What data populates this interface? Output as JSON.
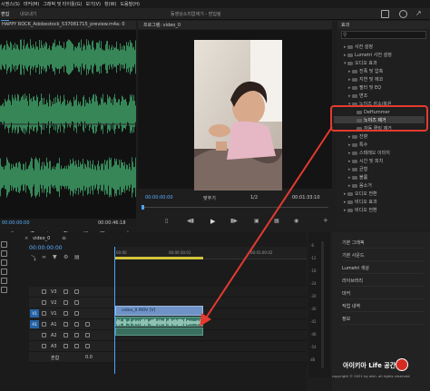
{
  "menubar": {
    "items": [
      "시퀀스(S)",
      "마커(M)",
      "그래픽 및 타이틀(G)",
      "보기(V)",
      "창(W)",
      "도움말(H)"
    ]
  },
  "tabs": {
    "edit": "편집",
    "export": "내보내기",
    "project_title": "동영상소리없애기 - 편집됨"
  },
  "source": {
    "title": "HAPPY ROCK_Adobestock_537081715_preview.m4a: 0",
    "tc_in": "00:00:00:00",
    "tc_out": "00:00:46:18"
  },
  "program": {
    "title": "프로그램: video_0",
    "tc_current": "00:00:00:00",
    "fit": "맞추기",
    "fraction": "1/2",
    "tc_duration": "00:01:33:10"
  },
  "effects": {
    "title": "효과",
    "items": [
      {
        "label": "사전 설정",
        "indent": 1,
        "open": false
      },
      {
        "label": "Lumetri 사전 설정",
        "indent": 1,
        "open": false
      },
      {
        "label": "오디오 효과",
        "indent": 1,
        "open": true
      },
      {
        "label": "진폭 및 압축",
        "indent": 2,
        "open": false
      },
      {
        "label": "지연 및 에코",
        "indent": 2,
        "open": false
      },
      {
        "label": "필터 및 EQ",
        "indent": 2,
        "open": false
      },
      {
        "label": "변조",
        "indent": 2,
        "open": false
      },
      {
        "label": "노이즈 감소/복원",
        "indent": 2,
        "open": true
      },
      {
        "label": "DeHummer",
        "indent": 3,
        "open": false
      },
      {
        "label": "노이즈 제거",
        "indent": 3,
        "open": false
      },
      {
        "label": "자동 클릭 제거",
        "indent": 3,
        "open": false
      },
      {
        "label": "잔향",
        "indent": 2,
        "open": false
      },
      {
        "label": "특수",
        "indent": 2,
        "open": false
      },
      {
        "label": "스테레오 이미지",
        "indent": 2,
        "open": false
      },
      {
        "label": "시간 및 피치",
        "indent": 2,
        "open": false
      },
      {
        "label": "균형",
        "indent": 2,
        "open": false
      },
      {
        "label": "볼륨",
        "indent": 2,
        "open": false
      },
      {
        "label": "음소거",
        "indent": 2,
        "open": false
      },
      {
        "label": "오디오 전환",
        "indent": 1,
        "open": false
      },
      {
        "label": "비디오 효과",
        "indent": 1,
        "open": false
      },
      {
        "label": "비디오 전환",
        "indent": 1,
        "open": false
      }
    ],
    "selected_index": 9
  },
  "timeline": {
    "sequence_name": "video_0",
    "timecode": "00:00:00:00",
    "ruler_ticks": [
      "00:00",
      "00:00:30:01",
      "00:01:00:02"
    ],
    "tracks": [
      {
        "label": "V3",
        "type": "video"
      },
      {
        "label": "V2",
        "type": "video"
      },
      {
        "label": "V1",
        "type": "video"
      },
      {
        "label": "A1",
        "type": "audio"
      },
      {
        "label": "A2",
        "type": "audio"
      },
      {
        "label": "A3",
        "type": "audio"
      },
      {
        "label": "혼합",
        "type": "mix",
        "value": "0.0"
      }
    ],
    "video_clip": "video_0.MOV [V]"
  },
  "meter": {
    "marks": [
      "-6",
      "-12",
      "-18",
      "-24",
      "-30",
      "-36",
      "-42",
      "-48",
      "-54",
      "dB"
    ]
  },
  "side_panel": {
    "items": [
      "기본 그래픽",
      "기본 사운드",
      "Lumetri 색상",
      "라이브러리",
      "마커",
      "작업 내역",
      "정보"
    ]
  },
  "watermark": {
    "text": "아이키아 Life 공간",
    "copyright": "copyright © 2021 by olsh. all rights reserved"
  },
  "colors": {
    "highlight": "#e53a2f",
    "accent_blue": "#4ea3ff",
    "video_clip": "#6f93c7",
    "audio_clip": "#3b7a6a",
    "work_area": "#d2c23a"
  }
}
